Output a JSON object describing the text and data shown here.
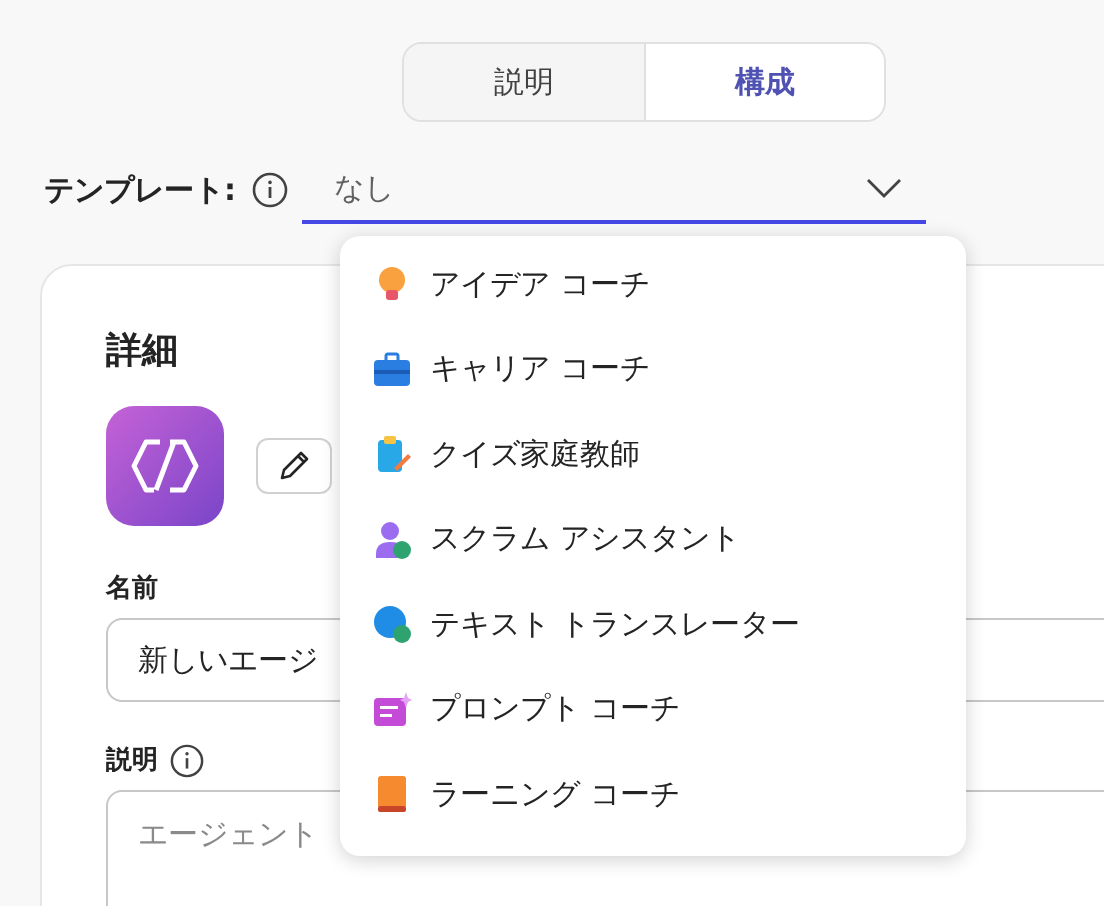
{
  "tabs": [
    {
      "label": "説明",
      "selected": false
    },
    {
      "label": "構成",
      "selected": true
    }
  ],
  "template": {
    "label": "テンプレート:",
    "value": "なし",
    "expanded": true
  },
  "template_options": [
    {
      "label": "アイデア コーチ",
      "kind": "bulb"
    },
    {
      "label": "キャリア コーチ",
      "kind": "briefcase"
    },
    {
      "label": "クイズ家庭教師",
      "kind": "clipboard"
    },
    {
      "label": "スクラム アシスタント",
      "kind": "person"
    },
    {
      "label": "テキスト トランスレーター",
      "kind": "globe"
    },
    {
      "label": "プロンプト コーチ",
      "kind": "note"
    },
    {
      "label": "ラーニング コーチ",
      "kind": "book"
    }
  ],
  "details": {
    "title": "詳細",
    "name_label": "名前",
    "name_value": "新しいエージ",
    "description_label": "説明",
    "description_placeholder": "エージェント"
  }
}
